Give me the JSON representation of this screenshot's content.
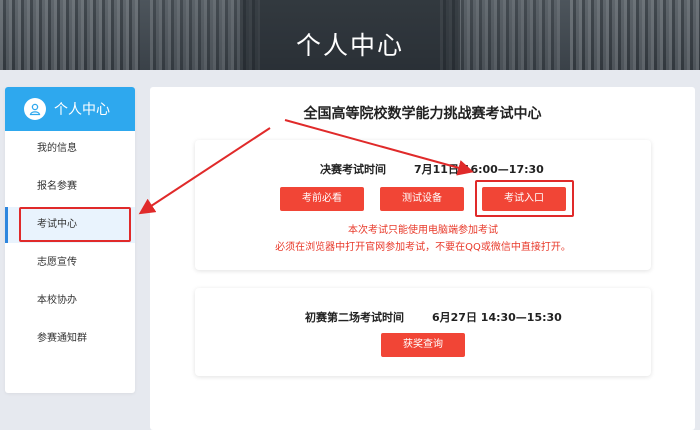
{
  "banner": {
    "title": "个人中心"
  },
  "sidebar": {
    "header": "个人中心",
    "items": [
      {
        "label": "我的信息"
      },
      {
        "label": "报名参赛"
      },
      {
        "label": "考试中心"
      },
      {
        "label": "志愿宣传"
      },
      {
        "label": "本校协办"
      },
      {
        "label": "参赛通知群"
      }
    ],
    "active": "考试中心"
  },
  "main": {
    "title": "全国高等院校数学能力挑战赛考试中心",
    "final_exam": {
      "label": "决赛考试时间",
      "time": "7月11日 16:00—17:30",
      "buttons": {
        "must_read": "考前必看",
        "test_device": "测试设备",
        "enter_exam": "考试入口"
      },
      "notice_1": "本次考试只能使用电脑端参加考试",
      "notice_2": "必须在浏览器中打开官网参加考试，不要在QQ或微信中直接打开。"
    },
    "prelim_exam": {
      "label": "初赛第二场考试时间",
      "time": "6月27日 14:30—15:30",
      "button": "获奖查询"
    }
  },
  "colors": {
    "accent_blue": "#2ea8ee",
    "button_red": "#f14536",
    "notice_red": "#e83a2b",
    "annotation_red": "#e02a2a"
  }
}
